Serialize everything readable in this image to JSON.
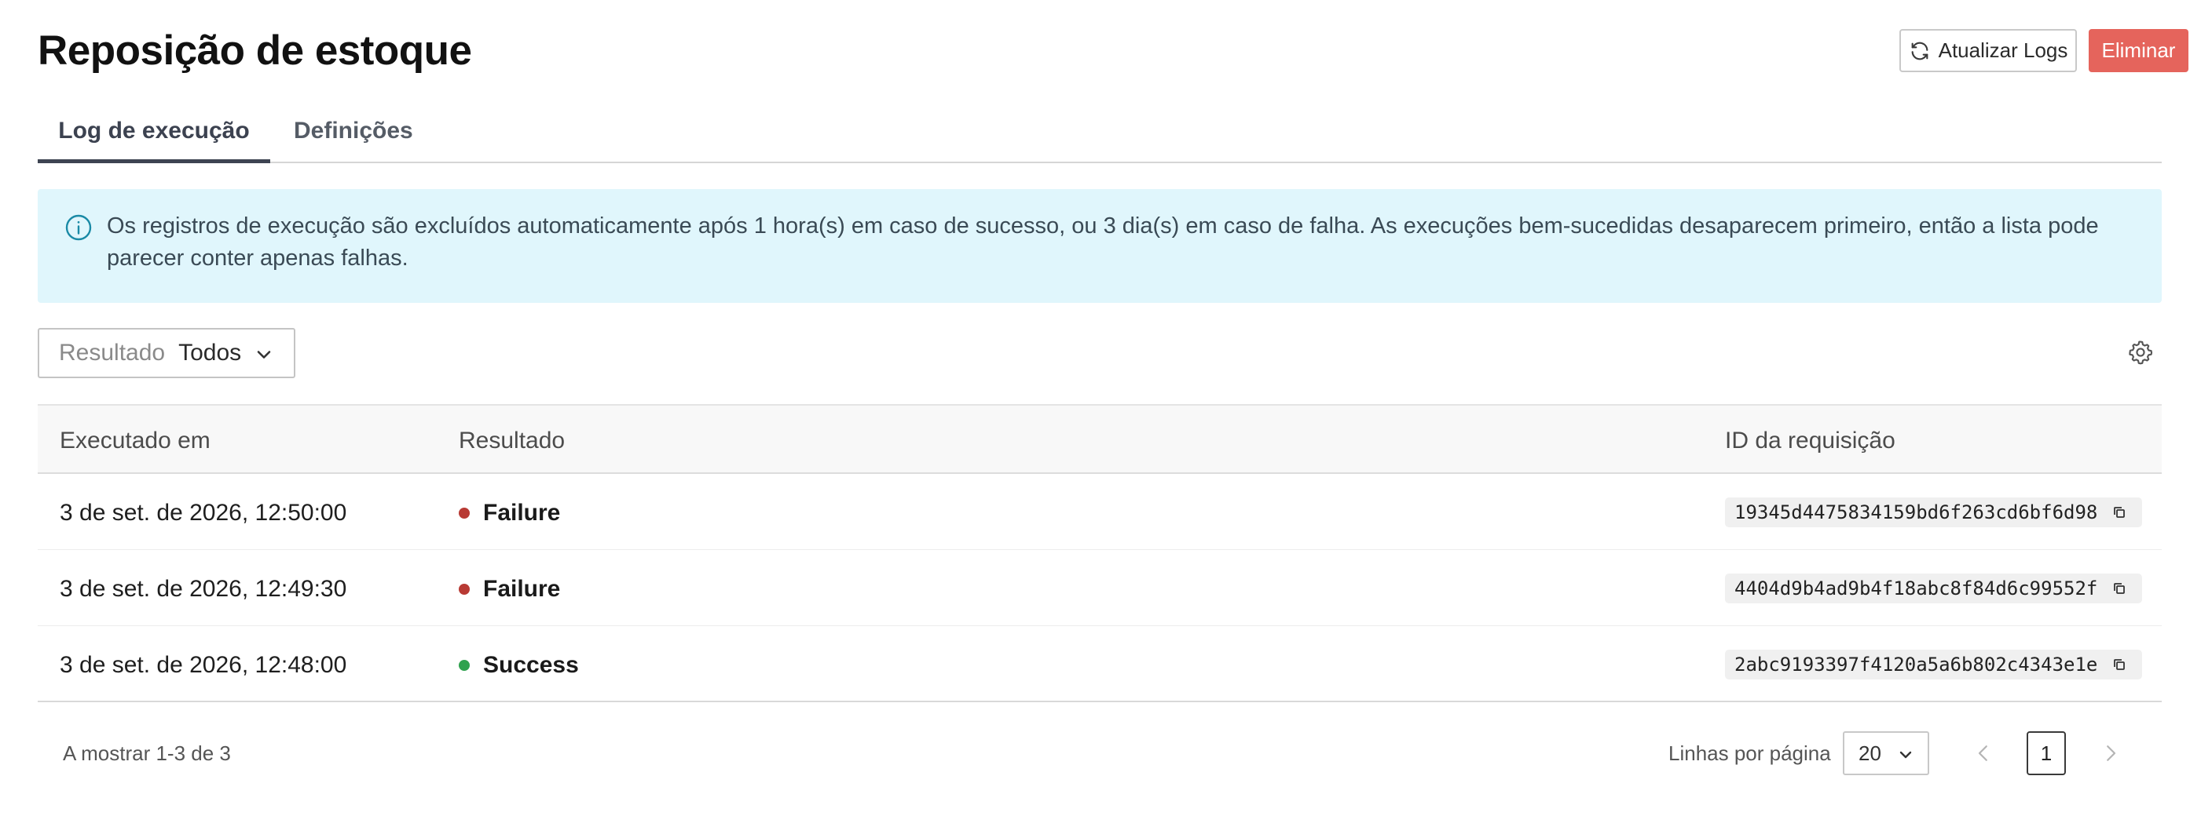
{
  "header": {
    "title": "Reposição de estoque",
    "refresh_label": "Atualizar Logs",
    "refresh_icon": "refresh-icon",
    "delete_label": "Eliminar",
    "delete_color": "#e5645c"
  },
  "tabs": [
    {
      "label": "Log de execução",
      "active": true
    },
    {
      "label": "Definições",
      "active": false
    }
  ],
  "banner": {
    "icon": "info-icon",
    "text": "Os registros de execução são excluídos automaticamente após 1 hora(s) em caso de sucesso, ou 3 dia(s) em caso de falha. As execuções bem-sucedidas desaparecem primeiro, então a lista pode parecer conter apenas falhas.",
    "background": "#e0f6fc",
    "icon_color": "#1a8aa6"
  },
  "filter": {
    "label": "Resultado",
    "value": "Todos"
  },
  "table": {
    "columns": [
      "Executado em",
      "Resultado",
      "ID da requisição"
    ],
    "rows": [
      {
        "executed_at": "3 de set. de 2026, 12:50:00",
        "result": "Failure",
        "status_color": "#b83a34",
        "request_id": "19345d4475834159bd6f263cd6bf6d98"
      },
      {
        "executed_at": "3 de set. de 2026, 12:49:30",
        "result": "Failure",
        "status_color": "#b83a34",
        "request_id": "4404d9b4ad9b4f18abc8f84d6c99552f"
      },
      {
        "executed_at": "3 de set. de 2026, 12:48:00",
        "result": "Success",
        "status_color": "#2fa24e",
        "request_id": "2abc9193397f4120a5a6b802c4343e1e"
      }
    ]
  },
  "footer": {
    "count_text": "A mostrar 1-3 de 3",
    "rows_per_page_label": "Linhas por página",
    "rows_per_page_value": "20",
    "current_page": "1"
  }
}
